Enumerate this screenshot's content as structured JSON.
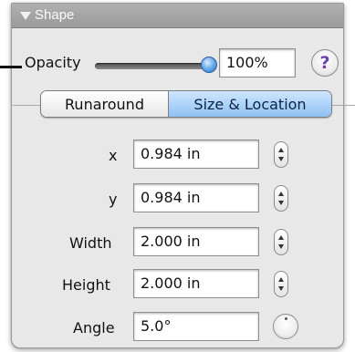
{
  "panel": {
    "title": "Shape"
  },
  "opacity": {
    "label": "Opacity",
    "value": "100%",
    "slider_level": 1.0
  },
  "help": {
    "label": "?"
  },
  "tabs": [
    {
      "label": "Runaround",
      "selected": false
    },
    {
      "label": "Size & Location",
      "selected": true
    }
  ],
  "fields": {
    "x": {
      "label": "x",
      "value": "0.984 in"
    },
    "y": {
      "label": "y",
      "value": "0.984 in"
    },
    "width": {
      "label": "Width",
      "value": "2.000 in"
    },
    "height": {
      "label": "Height",
      "value": "2.000 in"
    },
    "angle": {
      "label": "Angle",
      "value": "5.0°"
    }
  },
  "icons": {
    "disclosure": "disclosure-triangle-icon",
    "stepper": "stepper-arrows-icon",
    "angle_wheel": "angle-wheel-icon"
  },
  "colors": {
    "accent": "#8ec1f2",
    "slider_knob": "#4a90e2",
    "help": "#6a3fb0"
  }
}
